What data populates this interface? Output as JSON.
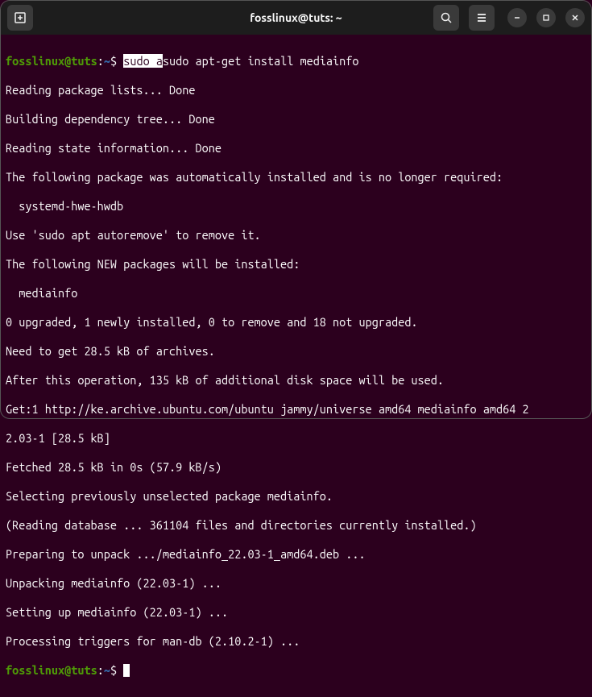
{
  "titlebar": {
    "title": "fosslinux@tuts: ~"
  },
  "prompt": {
    "user": "fosslinux",
    "at": "@",
    "host": "tuts",
    "colon": ":",
    "path": "~",
    "dollar": "$ "
  },
  "cmd1": {
    "highlight": "sudo a",
    "rest": "sudo apt-get install mediainfo"
  },
  "output": {
    "l1": "Reading package lists... Done",
    "l2": "Building dependency tree... Done",
    "l3": "Reading state information... Done",
    "l4": "The following package was automatically installed and is no longer required:",
    "l5": "  systemd-hwe-hwdb",
    "l6": "Use 'sudo apt autoremove' to remove it.",
    "l7": "The following NEW packages will be installed:",
    "l8": "  mediainfo",
    "l9": "0 upgraded, 1 newly installed, 0 to remove and 18 not upgraded.",
    "l10": "Need to get 28.5 kB of archives.",
    "l11": "After this operation, 135 kB of additional disk space will be used.",
    "l12": "Get:1 http://ke.archive.ubuntu.com/ubuntu jammy/universe amd64 mediainfo amd64 2",
    "l13": "2.03-1 [28.5 kB]",
    "l14": "Fetched 28.5 kB in 0s (57.9 kB/s)",
    "l15": "Selecting previously unselected package mediainfo.",
    "l16": "(Reading database ... 361104 files and directories currently installed.)",
    "l17": "Preparing to unpack .../mediainfo_22.03-1_amd64.deb ...",
    "l18": "Unpacking mediainfo (22.03-1) ...",
    "l19": "Setting up mediainfo (22.03-1) ...",
    "l20": "Processing triggers for man-db (2.10.2-1) ..."
  }
}
